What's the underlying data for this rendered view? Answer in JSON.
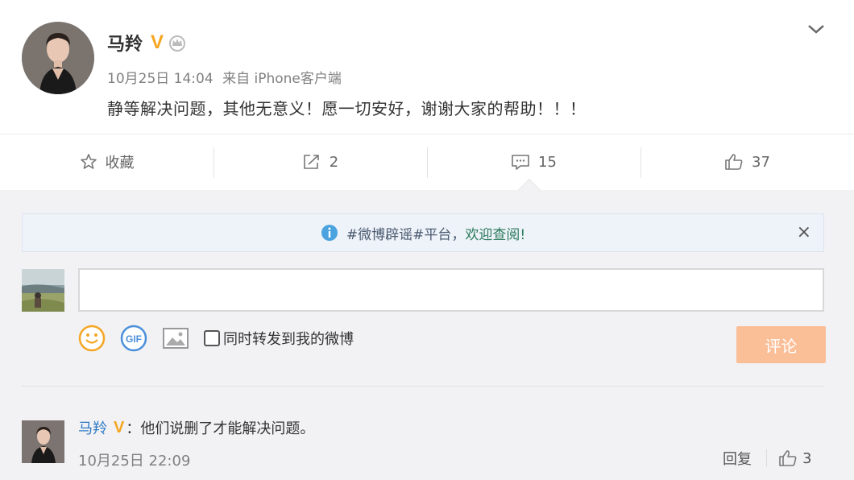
{
  "post": {
    "author": "马羚",
    "time": "10月25日 14:04",
    "source": "来自 iPhone客户端",
    "content": "静等解决问题，其他无意义！愿一切安好，谢谢大家的帮助！！！",
    "verified_badge": "V"
  },
  "actions": {
    "favorite_label": "收藏",
    "repost_count": "2",
    "comment_count": "15",
    "like_count": "37"
  },
  "notice": {
    "prefix": "#微博辟谣#平台，",
    "link": "欢迎查阅!",
    "close": "×"
  },
  "comment_box": {
    "value": "",
    "forward_label": "同时转发到我的微博",
    "submit_label": "评论"
  },
  "comments": [
    {
      "author": "马羚",
      "badge": "V",
      "separator": "：",
      "text": "他们说删了才能解决问题。",
      "time": "10月25日 22:09",
      "reply_label": "回复",
      "like_count": "3"
    }
  ],
  "colors": {
    "accent_orange": "#f5a623",
    "link_blue": "#2e79c4",
    "submit_bg": "#fbbf98"
  }
}
